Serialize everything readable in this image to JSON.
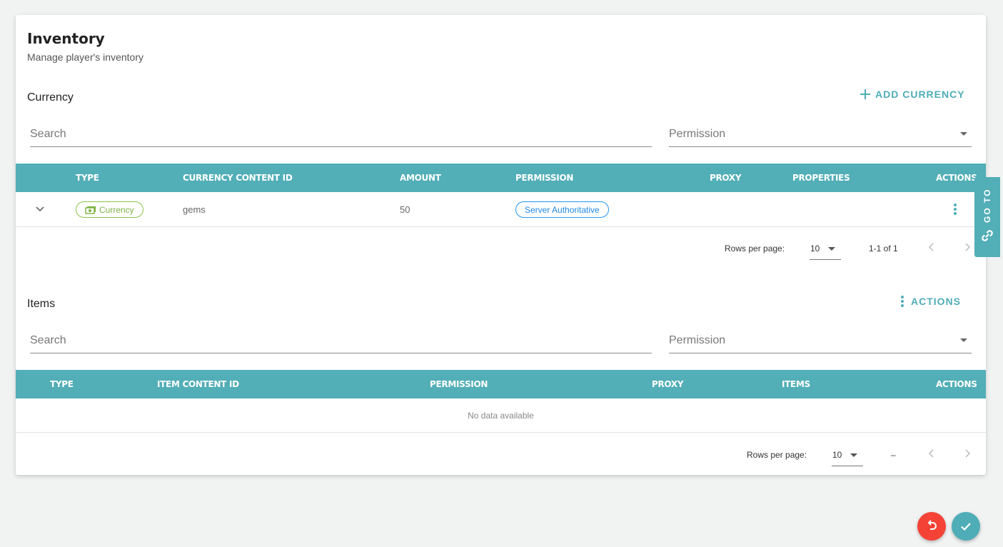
{
  "header": {
    "title": "Inventory",
    "subtitle": "Manage player's inventory"
  },
  "currency": {
    "section_title": "Currency",
    "add_button_label": "ADD CURRENCY",
    "search_placeholder": "Search",
    "permission_placeholder": "Permission",
    "columns": [
      "TYPE",
      "CURRENCY CONTENT ID",
      "AMOUNT",
      "PERMISSION",
      "PROXY",
      "PROPERTIES",
      "ACTIONS"
    ],
    "rows": [
      {
        "type": "Currency",
        "content_id": "gems",
        "amount": "50",
        "permission": "Server Authoritative",
        "proxy": "",
        "properties": ""
      }
    ],
    "pagination": {
      "rows_per_page_label": "Rows per page:",
      "rows_per_page": "10",
      "range": "1-1 of 1"
    }
  },
  "items": {
    "section_title": "Items",
    "actions_label": "ACTIONS",
    "search_placeholder": "Search",
    "permission_placeholder": "Permission",
    "columns": [
      "TYPE",
      "ITEM CONTENT ID",
      "PERMISSION",
      "PROXY",
      "ITEMS",
      "ACTIONS"
    ],
    "empty_text": "No data available",
    "pagination": {
      "rows_per_page_label": "Rows per page:",
      "rows_per_page": "10",
      "range": "–"
    }
  },
  "side_tab": {
    "label": "GO TO",
    "icon": "link-icon"
  },
  "fabs": {
    "revert_icon": "undo-icon",
    "confirm_icon": "check-icon"
  },
  "colors": {
    "accent": "#52aeb7",
    "fab_revert": "#f44336",
    "fab_confirm": "#4fadb7",
    "chip_currency": "#8bc34a",
    "chip_permission": "#2196f3"
  }
}
